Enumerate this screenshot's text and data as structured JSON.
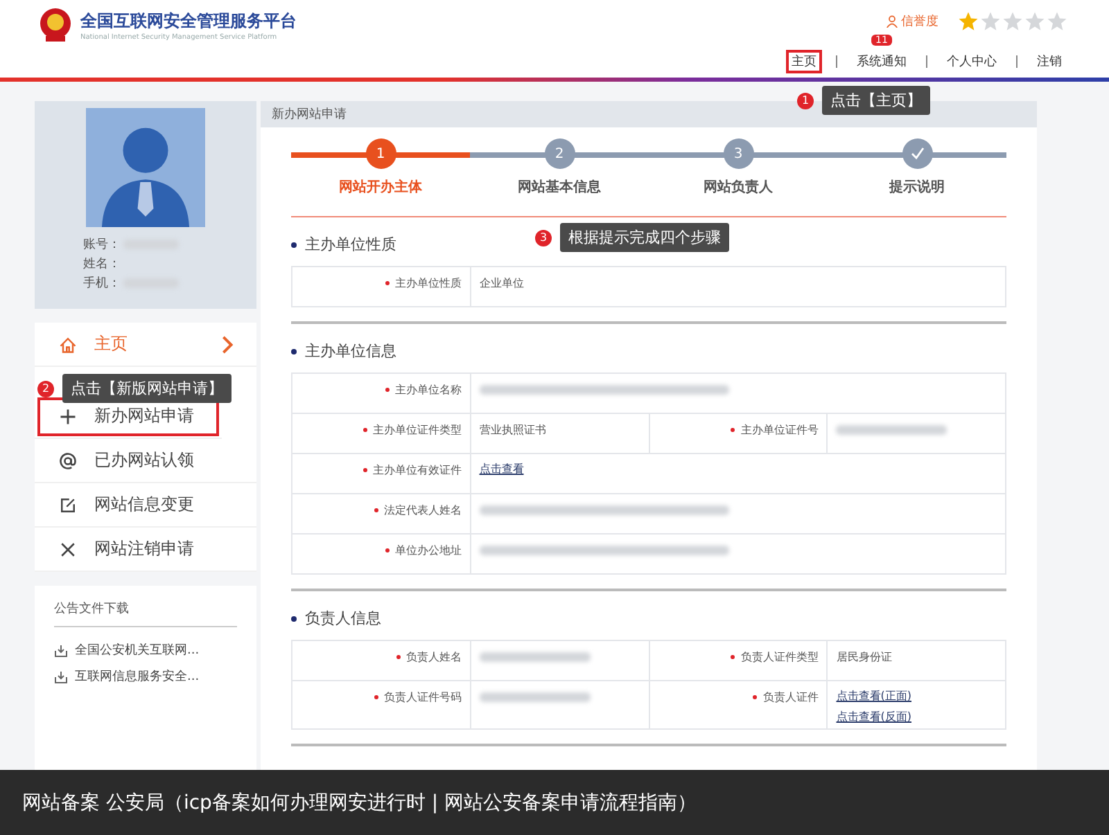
{
  "header": {
    "title": "全国互联网安全管理服务平台",
    "subtitle": "National Internet Security Management Service Platform",
    "credit_label": "信誉度",
    "stars": 1,
    "nav": [
      {
        "label": "主页",
        "highlighted": true
      },
      {
        "label": "系统通知",
        "highlighted": false,
        "badge": "11"
      },
      {
        "label": "个人中心",
        "highlighted": false
      },
      {
        "label": "注销",
        "highlighted": false
      }
    ]
  },
  "profile": {
    "fields": [
      "账号：",
      "姓名：",
      "手机："
    ]
  },
  "menu": [
    {
      "label": "主页",
      "selected": true,
      "highlighted": false
    },
    {
      "label": "新办网站申请",
      "selected": false,
      "highlighted": true
    },
    {
      "label": "已办网站认领",
      "selected": false,
      "highlighted": false
    },
    {
      "label": "网站信息变更",
      "selected": false,
      "highlighted": false
    },
    {
      "label": "网站注销申请",
      "selected": false,
      "highlighted": false
    }
  ],
  "downloads": {
    "title": "公告文件下载",
    "items": [
      "全国公安机关互联网...",
      "互联网信息服务安全..."
    ]
  },
  "panel": {
    "title": "新办网站申请",
    "steps": [
      {
        "kind": "number",
        "number": "1",
        "label": "网站开办主体",
        "selected": true
      },
      {
        "kind": "number",
        "number": "2",
        "label": "网站基本信息",
        "selected": false
      },
      {
        "kind": "number",
        "number": "3",
        "label": "网站负责人",
        "selected": false
      },
      {
        "kind": "finish",
        "label": "提示说明",
        "selected": false
      }
    ],
    "sections": [
      {
        "title": "主办单位性质",
        "rows": [
          [
            {
              "label": "主办单位性质",
              "kind": "text",
              "value": "企业单位"
            }
          ]
        ]
      },
      {
        "title": "主办单位信息",
        "rows": [
          [
            {
              "label": "主办单位名称",
              "kind": "blurred"
            }
          ],
          [
            {
              "label": "主办单位证件类型",
              "kind": "text",
              "value": "营业执照证书"
            },
            {
              "label": "主办单位证件号",
              "kind": "blurred"
            }
          ],
          [
            {
              "label": "主办单位有效证件",
              "kind": "links",
              "links": [
                "点击查看"
              ]
            }
          ],
          [
            {
              "label": "法定代表人姓名",
              "kind": "blurred"
            }
          ],
          [
            {
              "label": "单位办公地址",
              "kind": "blurred"
            }
          ]
        ]
      },
      {
        "title": "负责人信息",
        "rows": [
          [
            {
              "label": "负责人姓名",
              "kind": "blurred"
            },
            {
              "label": "负责人证件类型",
              "kind": "text",
              "value": "居民身份证"
            }
          ],
          [
            {
              "label": "负责人证件号码",
              "kind": "blurred"
            },
            {
              "label": "负责人证件",
              "kind": "links",
              "links": [
                "点击查看(正面)",
                "点击查看(反面)"
              ]
            }
          ]
        ]
      }
    ]
  },
  "annotations": [
    {
      "number": "1",
      "text": "点击【主页】"
    },
    {
      "number": "2",
      "text": "点击【新版网站申请】"
    },
    {
      "number": "3",
      "text": "根据提示完成四个步骤"
    }
  ],
  "caption": "网站备案 公安局（icp备案如何办理网安进行时 | 网站公安备案申请流程指南）"
}
